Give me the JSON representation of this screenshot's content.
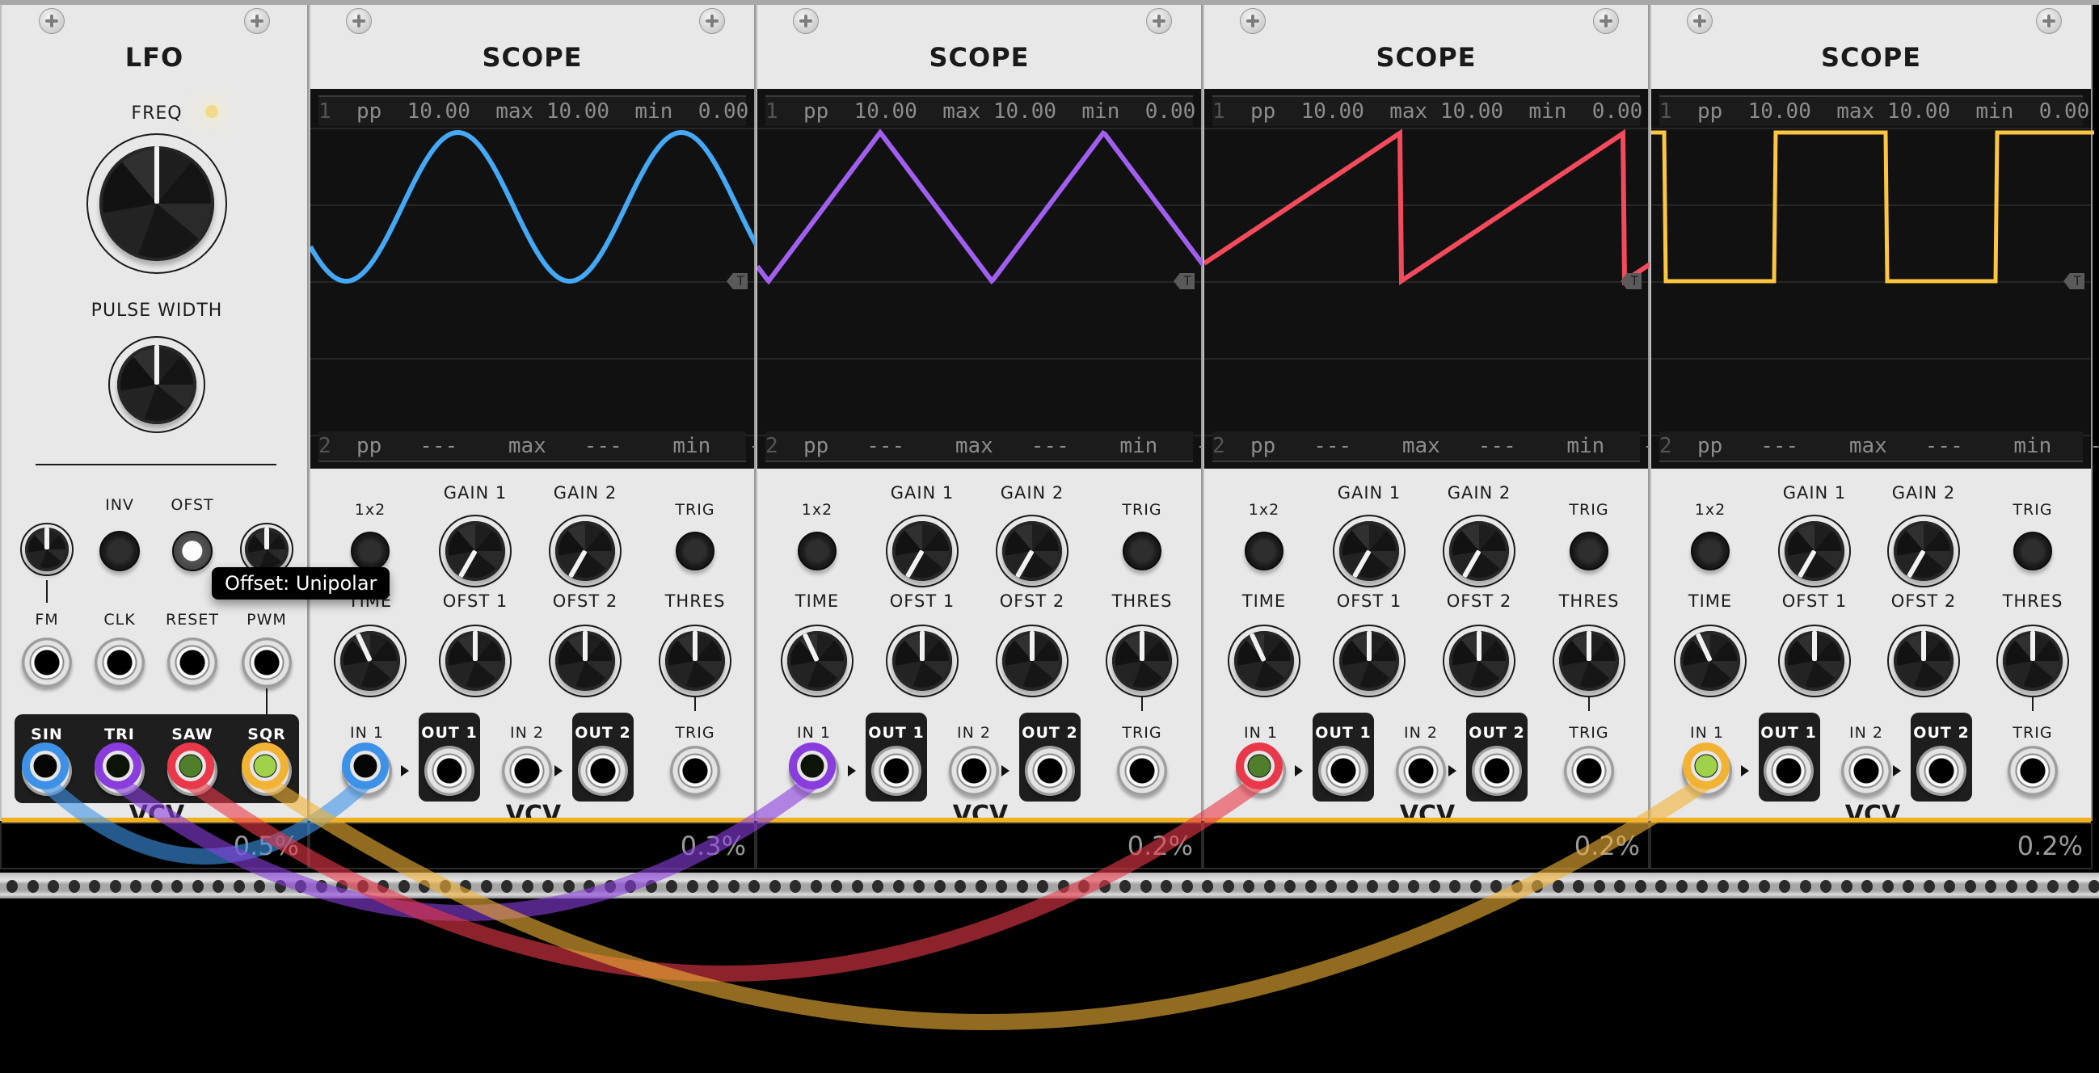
{
  "lfo": {
    "title": "LFO",
    "freq_label": "FREQ",
    "freq_value": 0.5,
    "pulse_width_label": "PULSE WIDTH",
    "pulse_width_value": 0.5,
    "fm_atten_value": 0.5,
    "pwm_atten_value": 0.5,
    "inv_label": "INV",
    "ofst_label": "OFST",
    "ofst_on": true,
    "inputs": [
      "FM",
      "CLK",
      "RESET",
      "PWM"
    ],
    "outputs": [
      "SIN",
      "TRI",
      "SAW",
      "SQR"
    ],
    "cpu": "0.5%"
  },
  "tooltip": "Offset: Unipolar",
  "scope_labels": {
    "title": "SCOPE",
    "x2": "1x2",
    "gain1": "GAIN 1",
    "gain2": "GAIN 2",
    "trig": "TRIG",
    "time": "TIME",
    "ofst1": "OFST 1",
    "ofst2": "OFST 2",
    "thres": "THRES",
    "in1": "IN 1",
    "out1": "OUT 1",
    "in2": "IN 2",
    "out2": "OUT 2",
    "trig_jack": "TRIG",
    "brand": "VCV",
    "trig_marker": "T"
  },
  "scopes": [
    {
      "cpu": "0.3%",
      "ch1": {
        "num": "1",
        "pp": "10.00",
        "max": "10.00",
        "min": "0.00"
      },
      "ch2": {
        "num": "2",
        "pp": "---",
        "max": "---",
        "min": "---"
      },
      "wave": "sine",
      "color": "#44a8f5"
    },
    {
      "cpu": "0.2%",
      "ch1": {
        "num": "1",
        "pp": "10.00",
        "max": "10.00",
        "min": "0.00"
      },
      "ch2": {
        "num": "2",
        "pp": "---",
        "max": "---",
        "min": "---"
      },
      "wave": "triangle",
      "color": "#a15ff0"
    },
    {
      "cpu": "0.2%",
      "ch1": {
        "num": "1",
        "pp": "10.00",
        "max": "10.00",
        "min": "0.00"
      },
      "ch2": {
        "num": "2",
        "pp": "---",
        "max": "---",
        "min": "---"
      },
      "wave": "saw",
      "color": "#f34a5c"
    },
    {
      "cpu": "0.2%",
      "ch1": {
        "num": "1",
        "pp": "10.00",
        "max": "10.00",
        "min": "0.00"
      },
      "ch2": {
        "num": "2",
        "pp": "---",
        "max": "---",
        "min": "---"
      },
      "wave": "square",
      "color": "#fcc640"
    }
  ],
  "scope_row_labels": {
    "pp": "pp",
    "max": "max",
    "min": "min"
  },
  "cables": [
    {
      "from": "lfo.sin",
      "to": "scope1.in1",
      "color": "#3d92e8"
    },
    {
      "from": "lfo.tri",
      "to": "scope2.in1",
      "color": "#8a3ddd"
    },
    {
      "from": "lfo.saw",
      "to": "scope3.in1",
      "color": "#e8384a"
    },
    {
      "from": "lfo.sqr",
      "to": "scope4.in1",
      "color": "#f2b233"
    }
  ]
}
